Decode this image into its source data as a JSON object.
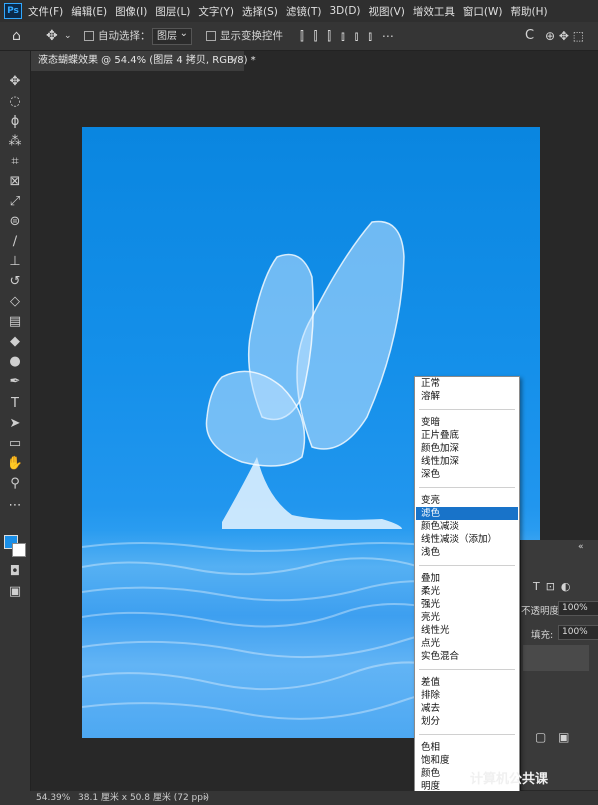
{
  "menubar": {
    "logo": "Ps",
    "items": [
      "文件(F)",
      "编辑(E)",
      "图像(I)",
      "图层(L)",
      "文字(Y)",
      "选择(S)",
      "滤镜(T)",
      "3D(D)",
      "视图(V)",
      "增效工具",
      "窗口(W)",
      "帮助(H)"
    ]
  },
  "options": {
    "auto_select_label": "自动选择：",
    "auto_select_value": "图层",
    "show_transform_label": "显示变换控件"
  },
  "document": {
    "tab_title": "液态蝴蝶效果 @ 54.4% (图层 4 拷贝, RGB/8) *",
    "close_glyph": "×"
  },
  "panel": {
    "opacity_label": "不透明度:",
    "opacity_value": "100%",
    "fill_label": "填充:",
    "fill_value": "100%"
  },
  "blend_menu": {
    "selected": "滤色",
    "groups": [
      [
        "正常",
        "溶解"
      ],
      [
        "变暗",
        "正片叠底",
        "颜色加深",
        "线性加深",
        "深色"
      ],
      [
        "变亮",
        "滤色",
        "颜色减淡",
        "线性减淡（添加）",
        "浅色"
      ],
      [
        "叠加",
        "柔光",
        "强光",
        "亮光",
        "线性光",
        "点光",
        "实色混合"
      ],
      [
        "差值",
        "排除",
        "减去",
        "划分"
      ],
      [
        "色相",
        "饱和度",
        "颜色",
        "明度"
      ]
    ]
  },
  "status": {
    "zoom": "54.39%",
    "doc_size": "38.1 厘米 x 50.8 厘米 (72 ppi)"
  },
  "watermark": "计算机公共课",
  "colors": {
    "foreground": "#1a8fe8",
    "background": "#ffffff",
    "selection": "#1873c9"
  }
}
